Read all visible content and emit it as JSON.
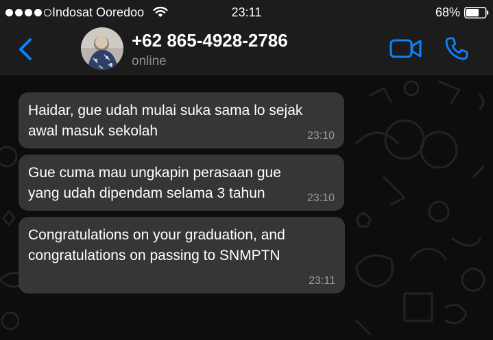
{
  "status_bar": {
    "carrier": "Indosat Ooredoo",
    "time": "23:11",
    "battery_percent": "68%",
    "battery_level": 0.68,
    "signal_bars": 4,
    "signal_total": 5
  },
  "header": {
    "contact_name": "+62 865-4928-2786",
    "contact_status": "online",
    "accent_color": "#0a84ff"
  },
  "messages": [
    {
      "text": "Haidar, gue udah mulai suka sama lo sejak\nawal masuk sekolah",
      "time": "23:10"
    },
    {
      "text": "Gue cuma mau ungkapin perasaan gue\nyang udah dipendam selama 3 tahun",
      "time": "23:10"
    },
    {
      "text": "Congratulations on your graduation, and\ncongratulations on passing to SNMPTN",
      "time": "23:11"
    }
  ],
  "icons": {
    "back": "chevron-left-icon",
    "video": "video-camera-icon",
    "voice": "phone-icon",
    "wifi": "wifi-icon",
    "battery": "battery-icon"
  }
}
